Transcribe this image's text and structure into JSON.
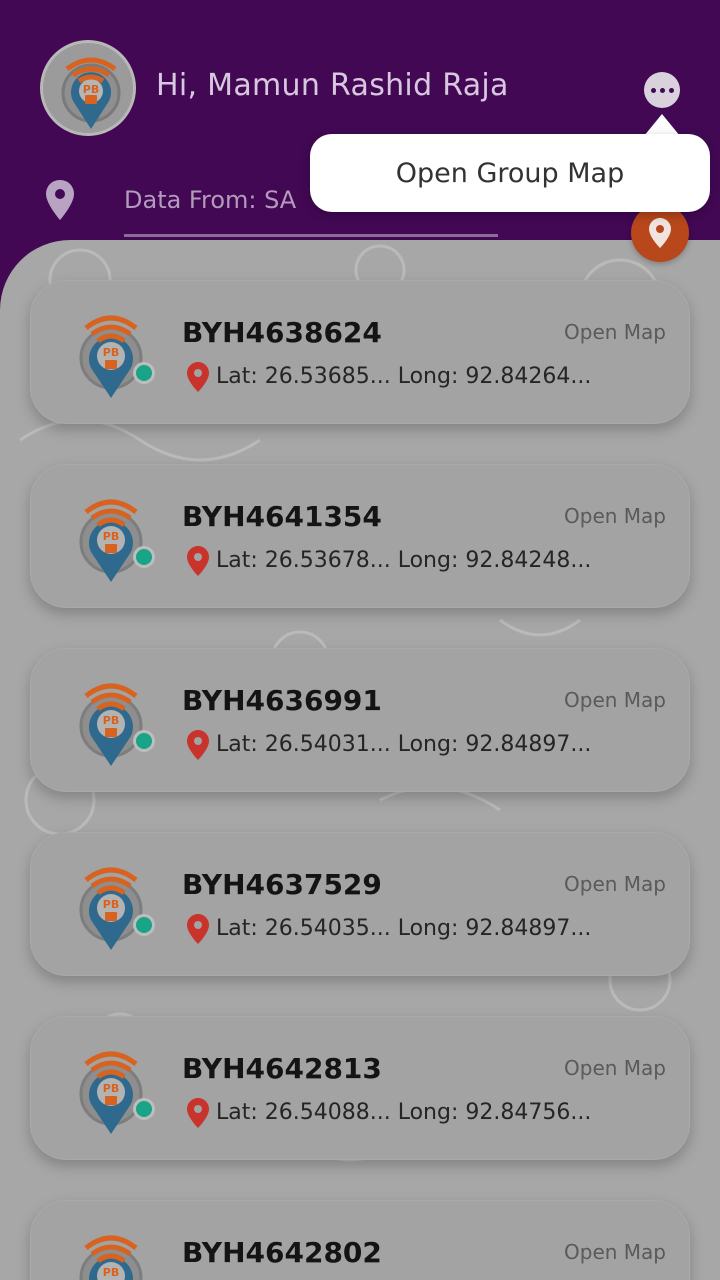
{
  "header": {
    "greeting": "Hi, Mamun Rashid Raja",
    "data_from": "Data From: SA",
    "menu_icon": "more-horizontal-icon",
    "location_icon": "map-pin-icon",
    "colors": {
      "header_bg": "#420854",
      "fab": "#b8471b",
      "online": "#17a487"
    }
  },
  "popup": {
    "label": "Open Group Map"
  },
  "devices": [
    {
      "id": "BYH4638624",
      "coords": "Lat: 26.53685... Long: 92.84264...",
      "action": "Open Map"
    },
    {
      "id": "BYH4641354",
      "coords": "Lat: 26.53678... Long: 92.84248...",
      "action": "Open Map"
    },
    {
      "id": "BYH4636991",
      "coords": "Lat: 26.54031... Long: 92.84897...",
      "action": "Open Map"
    },
    {
      "id": "BYH4637529",
      "coords": "Lat: 26.54035... Long: 92.84897...",
      "action": "Open Map"
    },
    {
      "id": "BYH4642813",
      "coords": "Lat: 26.54088... Long: 92.84756...",
      "action": "Open Map"
    },
    {
      "id": "BYH4642802",
      "coords": "",
      "action": "Open Map"
    }
  ],
  "logo_text": "PB"
}
